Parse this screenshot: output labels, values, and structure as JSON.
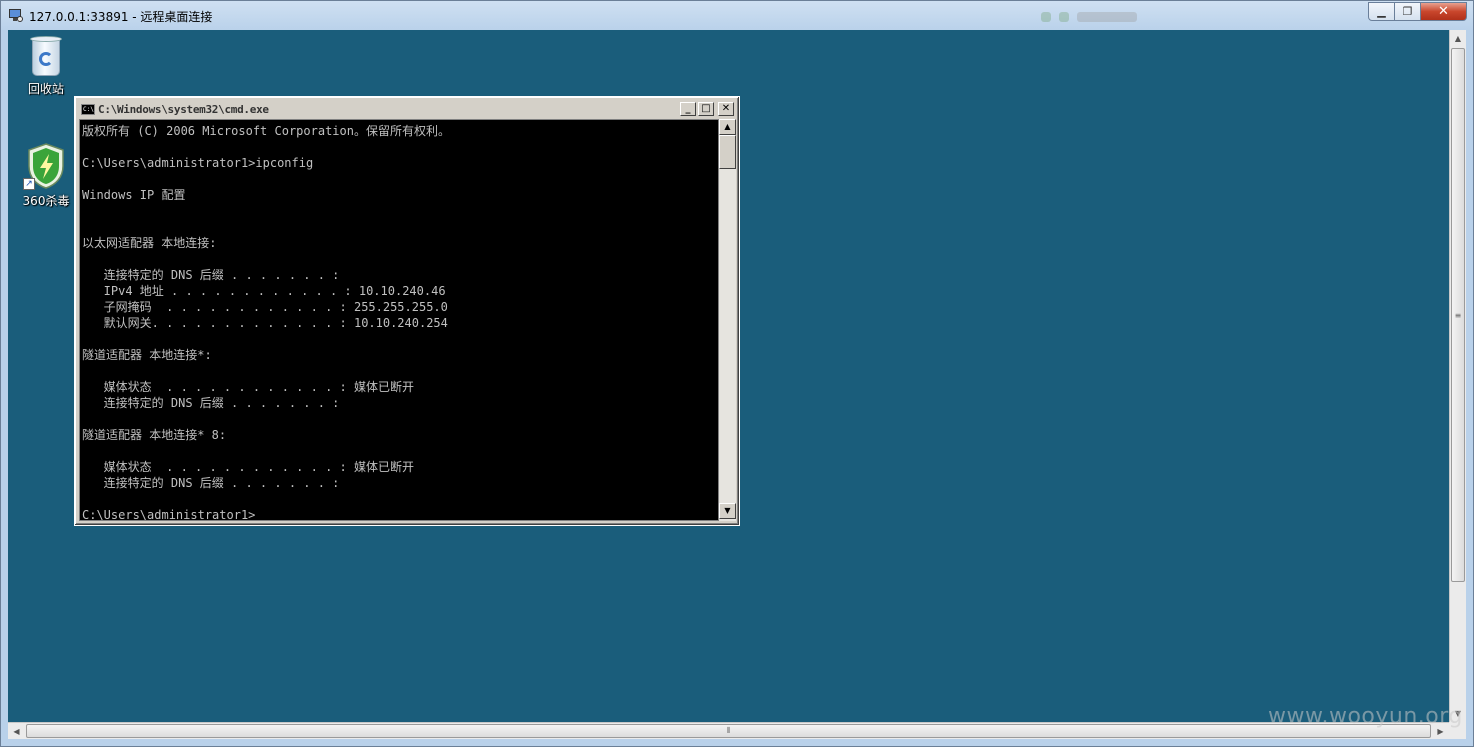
{
  "rdp": {
    "title": "127.0.0.1:33891 - 远程桌面连接"
  },
  "desktop": {
    "icons": [
      {
        "label": "回收站",
        "icon": "recycle-bin-icon"
      },
      {
        "label": "360杀毒",
        "icon": "antivirus-shield-icon"
      }
    ]
  },
  "cmd": {
    "title": "C:\\Windows\\system32\\cmd.exe",
    "lines": [
      "版权所有 (C) 2006 Microsoft Corporation。保留所有权利。",
      "",
      "C:\\Users\\administrator1>ipconfig",
      "",
      "Windows IP 配置",
      "",
      "",
      "以太网适配器 本地连接:",
      "",
      "   连接特定的 DNS 后缀 . . . . . . . :",
      "   IPv4 地址 . . . . . . . . . . . . : 10.10.240.46",
      "   子网掩码  . . . . . . . . . . . . : 255.255.255.0",
      "   默认网关. . . . . . . . . . . . . : 10.10.240.254",
      "",
      "隧道适配器 本地连接*:",
      "",
      "   媒体状态  . . . . . . . . . . . . : 媒体已断开",
      "   连接特定的 DNS 后缀 . . . . . . . :",
      "",
      "隧道适配器 本地连接* 8:",
      "",
      "   媒体状态  . . . . . . . . . . . . : 媒体已断开",
      "   连接特定的 DNS 后缀 . . . . . . . :",
      "",
      "C:\\Users\\administrator1>"
    ]
  },
  "watermark": "www.wooyun.org",
  "colors": {
    "desktop": "#1a5d7b",
    "console_bg": "#000000",
    "console_fg": "#c0c0c0"
  }
}
